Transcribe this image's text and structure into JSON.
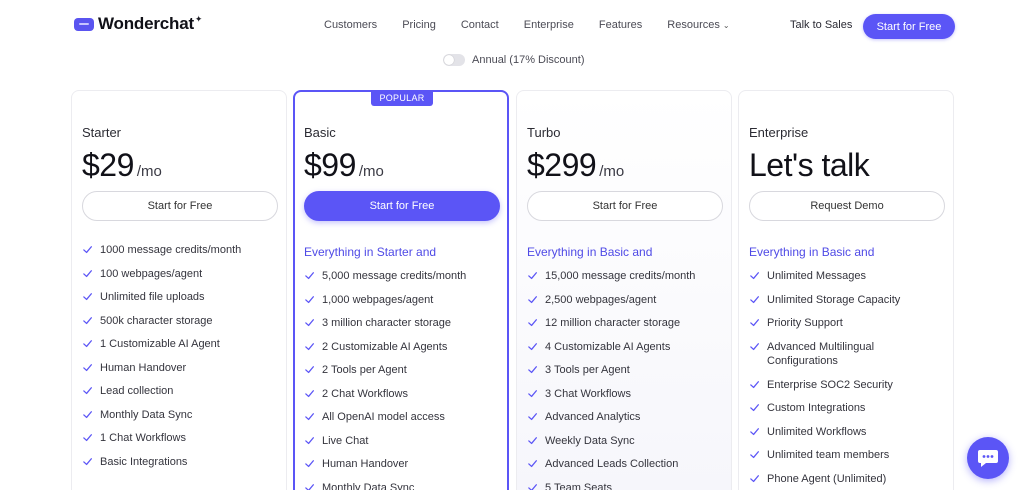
{
  "brand": {
    "name": "Wonderchat",
    "star": "✦",
    "accent": "#5b55f6"
  },
  "nav": {
    "links": [
      "Customers",
      "Pricing",
      "Contact",
      "Enterprise",
      "Features",
      "Resources"
    ],
    "resources_chevron": "⌄",
    "talk_to_sales": "Talk to Sales",
    "cta": "Start for Free"
  },
  "billing_toggle": {
    "label": "Annual (17% Discount)",
    "on": false
  },
  "plans": [
    {
      "name": "Starter",
      "price": "$29",
      "unit": "/mo",
      "popular": false,
      "button": "Start for Free",
      "feature_heading": "",
      "features": [
        "1000 message credits/month",
        "100 webpages/agent",
        "Unlimited file uploads",
        "500k character storage",
        "1 Customizable AI Agent",
        "Human Handover",
        "Lead collection",
        "Monthly Data Sync",
        "1 Chat Workflows",
        "Basic Integrations"
      ]
    },
    {
      "name": "Basic",
      "price": "$99",
      "unit": "/mo",
      "popular": true,
      "badge": "POPULAR",
      "button": "Start for Free",
      "feature_heading": "Everything in Starter and",
      "features": [
        "5,000 message credits/month",
        "1,000 webpages/agent",
        "3 million character storage",
        "2 Customizable AI Agents",
        "2 Tools per Agent",
        "2 Chat Workflows",
        "All OpenAI model access",
        "Live Chat",
        "Human Handover",
        "Monthly Data Sync"
      ]
    },
    {
      "name": "Turbo",
      "price": "$299",
      "unit": "/mo",
      "popular": false,
      "button": "Start for Free",
      "feature_heading": "Everything in Basic and",
      "features": [
        "15,000 message credits/month",
        "2,500 webpages/agent",
        "12 million character storage",
        "4 Customizable AI Agents",
        "3 Tools per Agent",
        "3 Chat Workflows",
        "Advanced Analytics",
        "Weekly Data Sync",
        "Advanced Leads Collection",
        "5 Team Seats"
      ]
    },
    {
      "name": "Enterprise",
      "price": "Let's talk",
      "unit": "",
      "popular": false,
      "button": "Request Demo",
      "feature_heading": "Everything in Basic and",
      "features": [
        "Unlimited Messages",
        "Unlimited Storage Capacity",
        "Priority Support",
        "Advanced Multilingual Configurations",
        "Enterprise SOC2 Security",
        "Custom Integrations",
        "Unlimited Workflows",
        "Unlimited team members",
        "Phone Agent (Unlimited)"
      ]
    }
  ],
  "chat_widget": {
    "icon": "chat-icon"
  }
}
